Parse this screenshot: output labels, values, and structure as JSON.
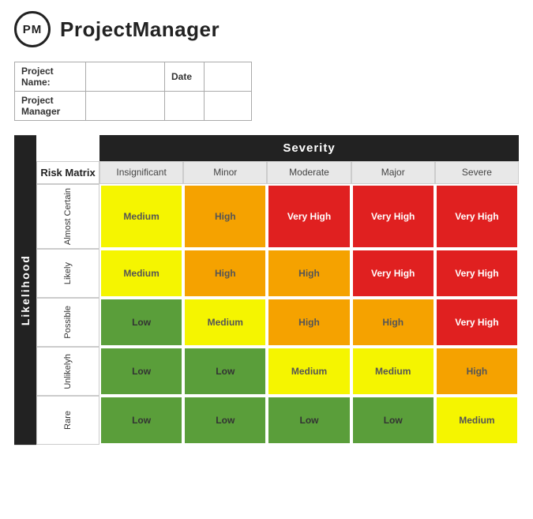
{
  "app": {
    "logo_text": "PM",
    "title": "ProjectManager"
  },
  "project_info": {
    "project_name_label": "Project Name:",
    "project_name_value": "",
    "project_manager_label": "Project Manager",
    "project_manager_value": "",
    "date_label": "Date",
    "date_value": ""
  },
  "matrix": {
    "likelihood_label": "Likelihood",
    "severity_label": "Severity",
    "risk_matrix_label": "Risk Matrix",
    "col_headers": [
      "Insignificant",
      "Minor",
      "Moderate",
      "Major",
      "Severe"
    ],
    "rows": [
      {
        "label": "Almost Certain",
        "cells": [
          "Medium",
          "High",
          "Very High",
          "Very High",
          "Very High"
        ],
        "types": [
          "medium",
          "high",
          "very-high",
          "very-high",
          "very-high"
        ]
      },
      {
        "label": "Likely",
        "cells": [
          "Medium",
          "High",
          "High",
          "Very High",
          "Very High"
        ],
        "types": [
          "medium",
          "high",
          "high",
          "very-high",
          "very-high"
        ]
      },
      {
        "label": "Possible",
        "cells": [
          "Low",
          "Medium",
          "High",
          "High",
          "Very High"
        ],
        "types": [
          "low",
          "medium",
          "high",
          "high",
          "very-high"
        ]
      },
      {
        "label": "Unlikelyh",
        "cells": [
          "Low",
          "Low",
          "Medium",
          "Medium",
          "High"
        ],
        "types": [
          "low",
          "low",
          "medium",
          "medium",
          "high"
        ]
      },
      {
        "label": "Rare",
        "cells": [
          "Low",
          "Low",
          "Low",
          "Low",
          "Medium"
        ],
        "types": [
          "low",
          "low",
          "low",
          "low",
          "medium"
        ]
      }
    ]
  }
}
